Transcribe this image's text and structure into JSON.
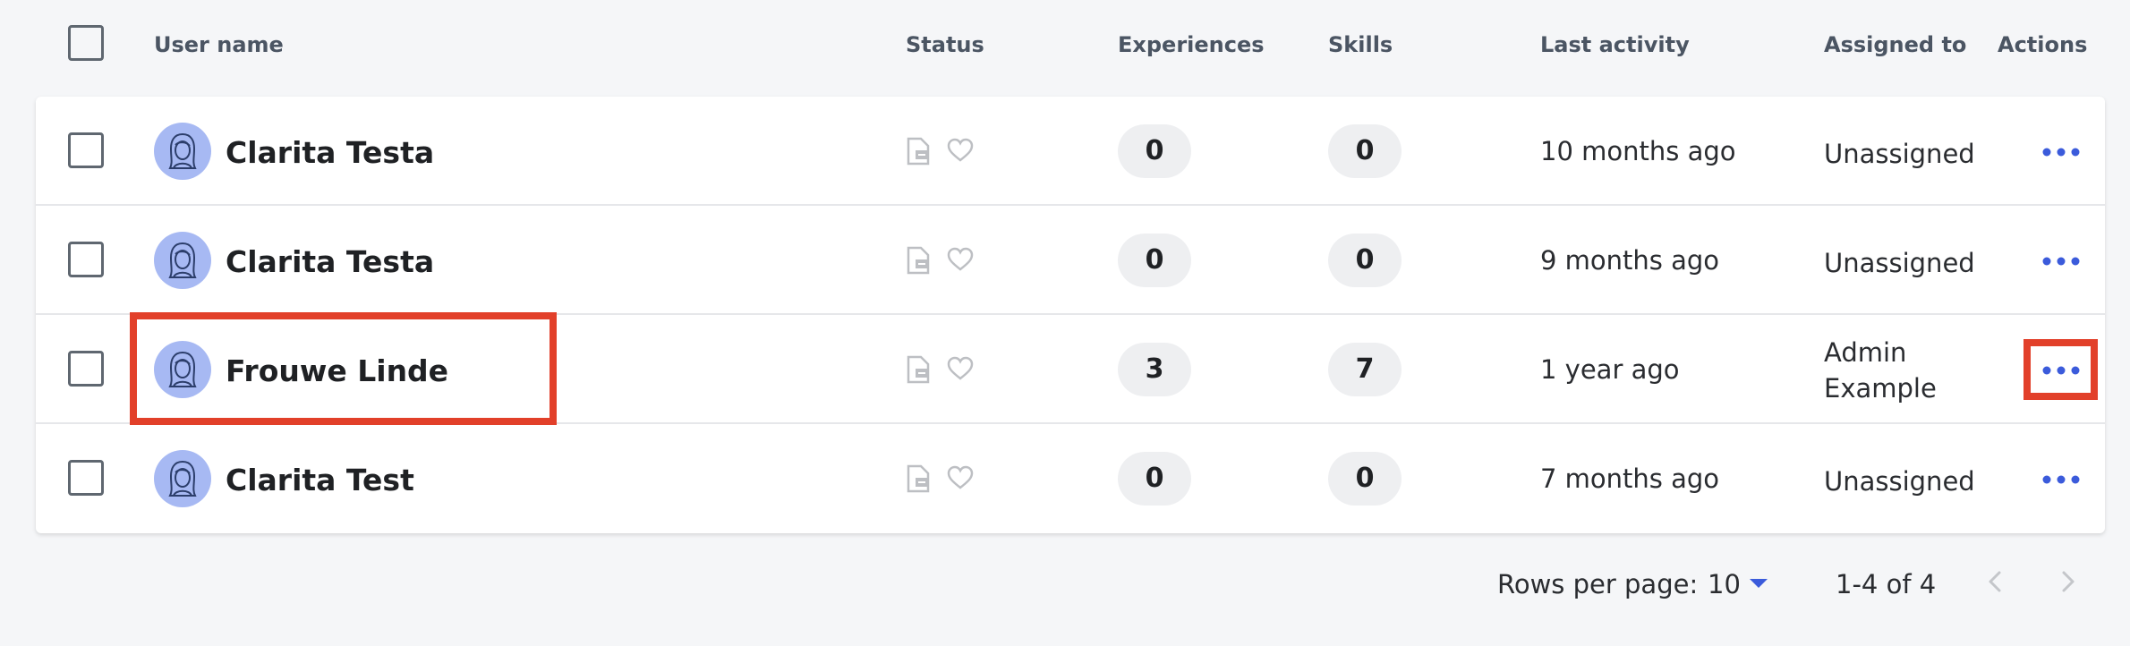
{
  "table": {
    "columns": {
      "user_name": "User name",
      "status": "Status",
      "experiences": "Experiences",
      "skills": "Skills",
      "last_activity": "Last activity",
      "assigned_to": "Assigned to",
      "actions": "Actions"
    },
    "rows": [
      {
        "name": "Clarita Testa",
        "experiences": "0",
        "skills": "0",
        "last_activity": "10 months ago",
        "assigned_to": "Unassigned"
      },
      {
        "name": "Clarita Testa",
        "experiences": "0",
        "skills": "0",
        "last_activity": "9 months ago",
        "assigned_to": "Unassigned"
      },
      {
        "name": "Frouwe Linde",
        "experiences": "3",
        "skills": "7",
        "last_activity": "1 year ago",
        "assigned_to": "Admin Example"
      },
      {
        "name": "Clarita Test",
        "experiences": "0",
        "skills": "0",
        "last_activity": "7 months ago",
        "assigned_to": "Unassigned"
      }
    ]
  },
  "pagination": {
    "rows_per_page_label": "Rows per page:",
    "rows_per_page": "10",
    "range": "1-4 of 4"
  },
  "colors": {
    "accent": "#3b5bdb",
    "highlight": "#e2402a",
    "avatar_bg": "#a7b9f3"
  },
  "icons": {
    "status_document": "document-icon",
    "status_favorite": "heart-icon",
    "actions": "more-horizontal-icon",
    "rows_select": "caret-down-icon",
    "prev": "chevron-left-icon",
    "next": "chevron-right-icon"
  }
}
